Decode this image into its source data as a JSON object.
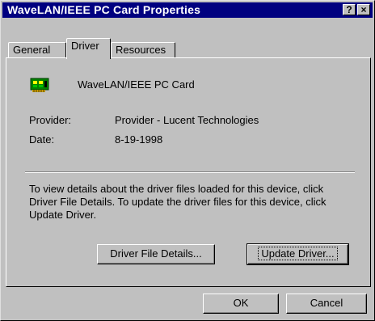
{
  "window": {
    "title": "WaveLAN/IEEE PC Card Properties",
    "help_glyph": "?",
    "close_glyph": "×"
  },
  "tabs": [
    {
      "label": "General",
      "active": false
    },
    {
      "label": "Driver",
      "active": true
    },
    {
      "label": "Resources",
      "active": false
    }
  ],
  "driver": {
    "device_name": "WaveLAN/IEEE PC Card",
    "provider_label": "Provider:",
    "provider_value": "Provider - Lucent Technologies",
    "date_label": "Date:",
    "date_value": "8-19-1998",
    "description": "To view details about the driver files loaded for this device, click Driver File Details.  To update the driver files for this device, click Update Driver.",
    "details_button": "Driver File Details...",
    "update_button": "Update Driver..."
  },
  "footer": {
    "ok_button": "OK",
    "cancel_button": "Cancel"
  },
  "colors": {
    "titlebar": "#000080",
    "face": "#c0c0c0"
  },
  "icons": {
    "device": "network-card-icon"
  }
}
